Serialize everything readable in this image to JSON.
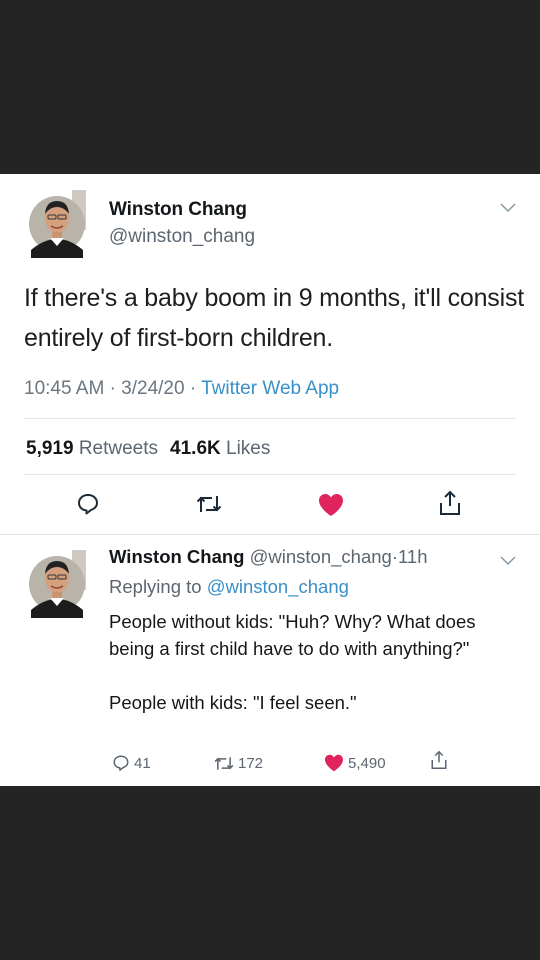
{
  "colors": {
    "link": "#3a8fc8",
    "like": "#e0245e",
    "muted": "#5b6670",
    "backdrop": "#242424"
  },
  "main_tweet": {
    "author_name": "Winston Chang",
    "author_handle": "@winston_chang",
    "text": "If there's a baby boom in 9 months, it'll consist entirely of first-born children.",
    "time": "10:45 AM",
    "date": "3/24/20",
    "separator": "·",
    "source": "Twitter Web App",
    "retweets_count": "5,919",
    "retweets_label": "Retweets",
    "likes_count": "41.6K",
    "likes_label": "Likes",
    "liked": true,
    "actions": [
      "reply-icon",
      "retweet-icon",
      "heart-icon",
      "share-icon"
    ]
  },
  "reply_tweet": {
    "author_name": "Winston Chang",
    "author_handle": "@winston_chang",
    "separator": "·",
    "age": "11h",
    "replying_prefix": "Replying to",
    "replying_handle": "@winston_chang",
    "paragraph_1": "People without kids: \"Huh? Why? What does being a first child have to do with anything?\"",
    "paragraph_2": "People with kids: \"I feel seen.\"",
    "reply_count": "41",
    "retweet_count": "172",
    "like_count": "5,490",
    "liked": true
  }
}
